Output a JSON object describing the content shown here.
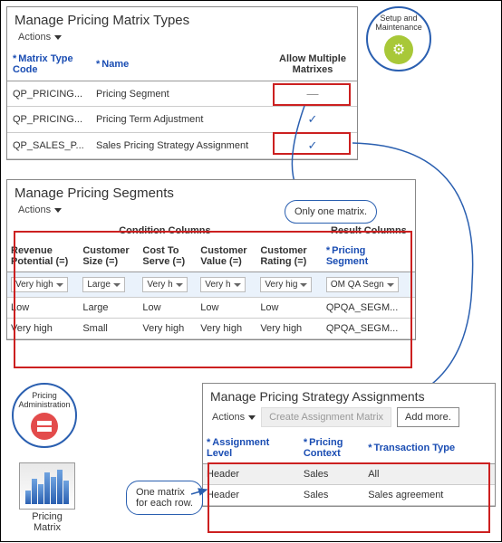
{
  "badge_setup": {
    "line1": "Setup and",
    "line2": "Maintenance"
  },
  "badge_admin": {
    "line1": "Pricing",
    "line2": "Administration"
  },
  "matrix_icon_label": "Pricing\nMatrix",
  "panel1": {
    "title": "Manage Pricing Matrix Types",
    "actions": "Actions",
    "cols": {
      "code": "Matrix Type\nCode",
      "name": "Name",
      "allow": "Allow Multiple\nMatrixes"
    },
    "rows": [
      {
        "code": "QP_PRICING...",
        "name": "Pricing Segment",
        "allow": "—"
      },
      {
        "code": "QP_PRICING...",
        "name": "Pricing Term Adjustment",
        "allow": "✓"
      },
      {
        "code": "QP_SALES_P...",
        "name": "Sales Pricing Strategy Assignment",
        "allow": "✓"
      }
    ]
  },
  "callout_one": "Only one matrix.",
  "callout_each": "One matrix\nfor each row.",
  "panel2": {
    "title": "Manage Pricing Segments",
    "actions": "Actions",
    "group_cond": "Condition Columns",
    "group_res": "Result Columns",
    "cols": {
      "rev": "Revenue\nPotential (=)",
      "size": "Customer\nSize (=)",
      "cost": "Cost To\nServe (=)",
      "val": "Customer\nValue (=)",
      "rating": "Customer\nRating (=)",
      "seg": "Pricing\nSegment"
    },
    "rows": [
      {
        "rev": "Very high",
        "size": "Large",
        "cost": "Very h",
        "val": "Very h",
        "rating": "Very hig",
        "seg": "OM QA Segn",
        "sel": true
      },
      {
        "rev": "Low",
        "size": "Large",
        "cost": "Low",
        "val": "Low",
        "rating": "Low",
        "seg": "QPQA_SEGM...",
        "sel": false
      },
      {
        "rev": "Very high",
        "size": "Small",
        "cost": "Very high",
        "val": "Very high",
        "rating": "Very high",
        "seg": "QPQA_SEGM...",
        "sel": false
      }
    ]
  },
  "panel3": {
    "title": "Manage Pricing Strategy Assignments",
    "actions": "Actions",
    "create": "Create Assignment Matrix",
    "addmore": "Add more.",
    "cols": {
      "lvl": "Assignment\nLevel",
      "ctx": "Pricing\nContext",
      "ttype": "Transaction Type"
    },
    "rows": [
      {
        "lvl": "Header",
        "ctx": "Sales",
        "ttype": "All",
        "hl": true
      },
      {
        "lvl": "Header",
        "ctx": "Sales",
        "ttype": "Sales agreement",
        "hl": false
      }
    ]
  }
}
